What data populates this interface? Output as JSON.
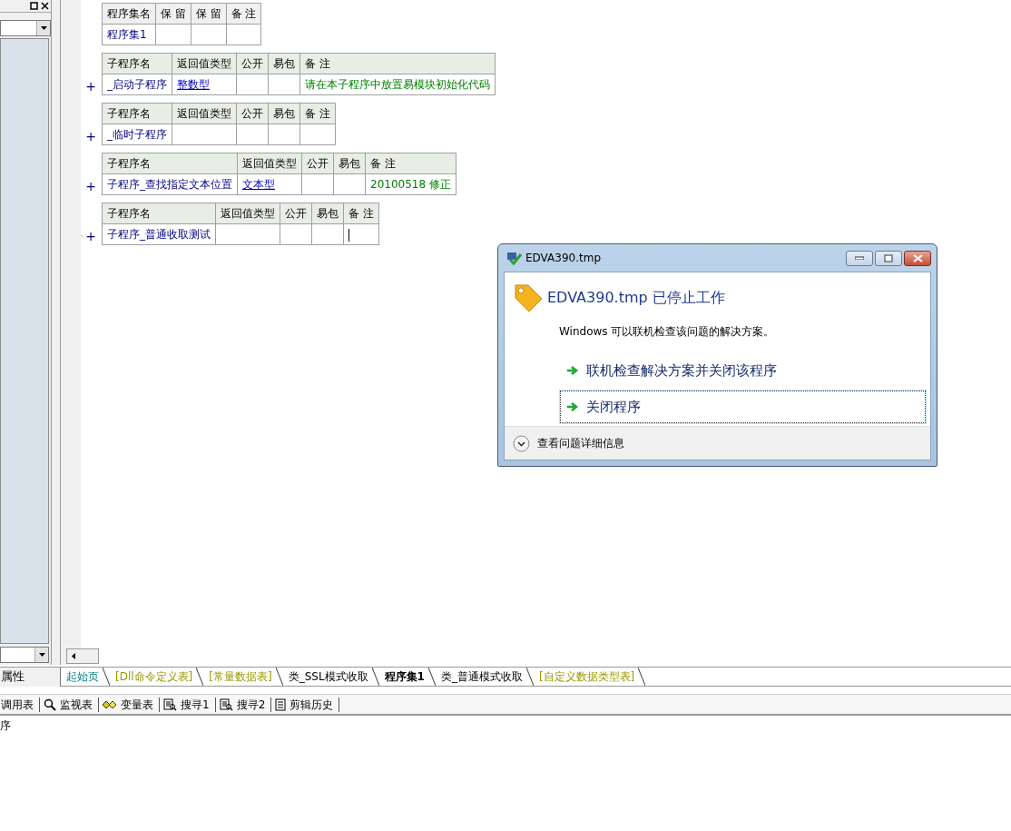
{
  "left_panel": {
    "tab": "属性"
  },
  "assembly": {
    "columns": [
      "程序集名",
      "保 留",
      "保 留",
      "备 注"
    ],
    "name": "程序集1"
  },
  "subroutines": [
    {
      "expander": "+",
      "editing": false,
      "columns": [
        "子程序名",
        "返回值类型",
        "公开",
        "易包",
        "备 注"
      ],
      "name": "_启动子程序",
      "return_type": "整数型",
      "note": "请在本子程序中放置易模块初始化代码"
    },
    {
      "expander": "+",
      "editing": false,
      "columns": [
        "子程序名",
        "返回值类型",
        "公开",
        "易包",
        "备 注"
      ],
      "name": "_临时子程序"
    },
    {
      "expander": "+",
      "editing": false,
      "columns": [
        "子程序名",
        "返回值类型",
        "公开",
        "易包",
        "备 注"
      ],
      "name": "子程序_查找指定文本位置",
      "return_type": "文本型",
      "note": "20100518 修正"
    },
    {
      "expander": "+",
      "editing": true,
      "columns": [
        "子程序名",
        "返回值类型",
        "公开",
        "易包",
        "备 注"
      ],
      "name": "子程序_普通收取测试"
    }
  ],
  "tabs": [
    {
      "label": "起始页",
      "kind": "start",
      "selected": false
    },
    {
      "label": "[Dll命令定义表]",
      "kind": "table",
      "selected": false
    },
    {
      "label": "[常量数据表]",
      "kind": "table",
      "selected": false
    },
    {
      "label": "类_SSL模式收取",
      "kind": "code",
      "selected": false
    },
    {
      "label": "程序集1",
      "kind": "code",
      "selected": true
    },
    {
      "label": "类_普通模式收取",
      "kind": "code",
      "selected": false
    },
    {
      "label": "[自定义数据类型表]",
      "kind": "table",
      "selected": false
    }
  ],
  "toolbar": [
    {
      "label": "调用表",
      "kind": "plain"
    },
    {
      "label": "监视表",
      "kind": "watch"
    },
    {
      "label": "变量表",
      "kind": "variables"
    },
    {
      "label": "搜寻1",
      "kind": "find"
    },
    {
      "label": "搜寻2",
      "kind": "find"
    },
    {
      "label": "剪辑历史",
      "kind": "history"
    }
  ],
  "output_text": "序",
  "dialog": {
    "title": "EDVA390.tmp",
    "heading": "EDVA390.tmp 已停止工作",
    "message": "Windows 可以联机检查该问题的解决方案。",
    "options": [
      {
        "label": "联机检查解决方案并关闭该程序",
        "focused": false
      },
      {
        "label": "关闭程序",
        "focused": true
      }
    ],
    "details": "查看问题详细信息"
  }
}
